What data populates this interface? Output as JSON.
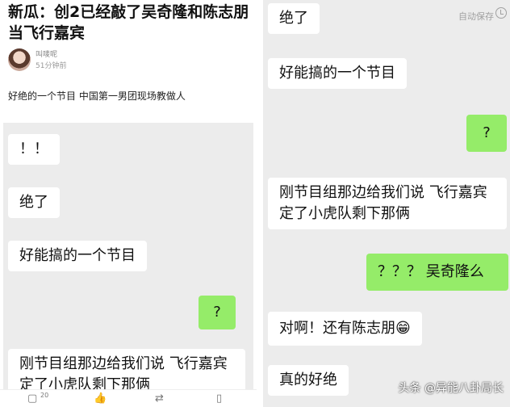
{
  "article": {
    "title": "新瓜：创2已经敲了吴奇隆和陈志朋当飞行嘉宾",
    "author": "叫唛呢",
    "time": "51分钟前",
    "description": "好绝的一个节目 中国第一男团现场教做人"
  },
  "left_chat": [
    {
      "text": "！！",
      "side": "left"
    },
    {
      "text": "绝了",
      "side": "left"
    },
    {
      "text": "好能搞的一个节目",
      "side": "left"
    },
    {
      "text": "?",
      "side": "right"
    },
    {
      "text": "刚节目组那边给我们说 飞行嘉宾定了小虎队剩下那俩",
      "side": "left"
    }
  ],
  "bottom_bar": {
    "comment_count": "20"
  },
  "right_panel": {
    "autosave_label": "自动保存",
    "watermark": "头条 @异能八卦局长",
    "messages": [
      {
        "text": "绝了",
        "side": "left"
      },
      {
        "text": "好能搞的一个节目",
        "side": "left"
      },
      {
        "text": "?",
        "side": "right"
      },
      {
        "text": "刚节目组那边给我们说 飞行嘉宾定了小虎队剩下那俩",
        "side": "left"
      },
      {
        "text": "？？？ 吴奇隆么",
        "side": "right"
      },
      {
        "text": "对啊！还有陈志朋😁",
        "side": "left"
      },
      {
        "text": "真的好绝",
        "side": "left"
      }
    ]
  },
  "colors": {
    "chat_bg": "#ececec",
    "bubble_green": "#95ec69",
    "bubble_white": "#ffffff"
  }
}
